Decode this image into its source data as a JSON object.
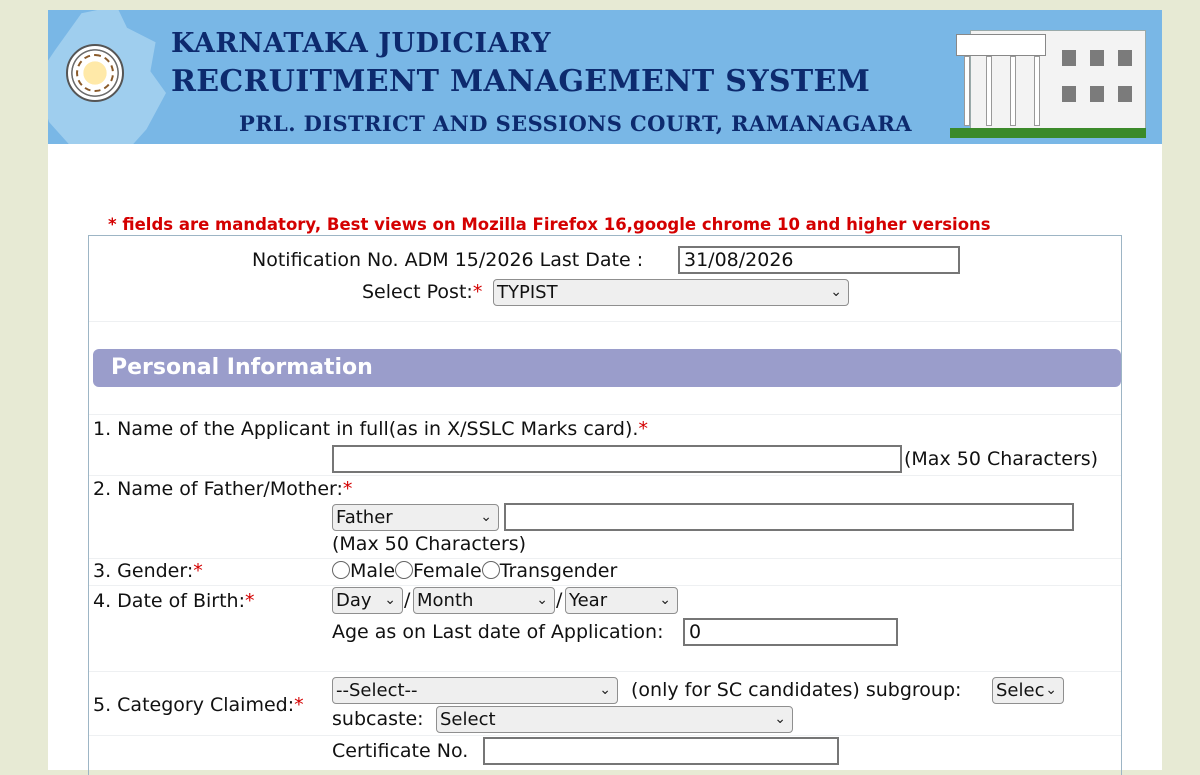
{
  "header": {
    "line1": "KARNATAKA JUDICIARY",
    "line2": "RECRUITMENT MANAGEMENT SYSTEM",
    "line3": "PRL. DISTRICT AND SESSIONS COURT, RAMANAGARA"
  },
  "notice": "* fields are mandatory, Best views on Mozilla Firefox 16,google chrome 10 and higher versions",
  "notification": {
    "label": "Notification No. ADM 15/2026 Last Date :",
    "last_date_value": "31/08/2026",
    "select_post_label": "Select Post:",
    "select_post_value": "TYPIST"
  },
  "section_personal": "Personal Information",
  "fields": {
    "name": {
      "label": "1. Name of the Applicant in full(as in X/SSLC Marks card).",
      "value": "",
      "hint": "(Max 50 Characters)"
    },
    "parent": {
      "label": "2. Name of Father/Mother:",
      "relation_value": "Father",
      "value": "",
      "hint": "(Max 50 Characters)"
    },
    "gender": {
      "label": "3. Gender:",
      "options": [
        "Male",
        "Female",
        "Transgender"
      ]
    },
    "dob": {
      "label": "4. Date of Birth:",
      "day": "Day",
      "month": "Month",
      "year": "Year",
      "separator": "/",
      "age_label": "Age as on Last date of Application:",
      "age_value": "0"
    },
    "category": {
      "label": "5. Category Claimed:",
      "value": "--Select--",
      "sc_note": "(only for SC candidates) subgroup:",
      "subgroup_value": "Selec",
      "subcaste_label": "subcaste:",
      "subcaste_value": "Select",
      "certificate_label": "Certificate No.",
      "certificate_value": ""
    }
  },
  "required_mark": "*",
  "chevron": "⌄",
  "colors": {
    "banner": "#79b7e6",
    "banner_text": "#0d2a6e",
    "notice": "#d40000",
    "section_header": "#9a9dcb",
    "page_bg": "#e7ead4"
  }
}
